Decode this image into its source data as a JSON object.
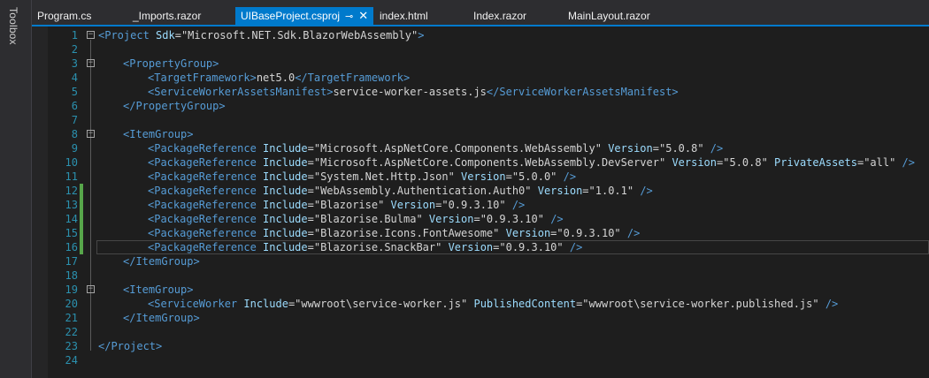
{
  "toolbox": {
    "label": "Toolbox"
  },
  "tabs": [
    {
      "label": "Program.cs",
      "active": false
    },
    {
      "label": "_Imports.razor",
      "active": false
    },
    {
      "label": "UIBaseProject.csproj",
      "active": true
    },
    {
      "label": "index.html",
      "active": false
    },
    {
      "label": "Index.razor",
      "active": false
    },
    {
      "label": "MainLayout.razor",
      "active": false
    }
  ],
  "colors": {
    "accent": "#007acc",
    "tag": "#569cd6",
    "attr": "#9cdcfe",
    "linenum": "#2b91af",
    "changed": "#57a64a"
  },
  "editor": {
    "lines": [
      {
        "n": "1",
        "fold": "minus",
        "changed": false,
        "indent": 0,
        "tokens": [
          [
            "tag",
            "<Project "
          ],
          [
            "attr",
            "Sdk"
          ],
          [
            "val",
            "=\"Microsoft.NET.Sdk.BlazorWebAssembly\""
          ],
          [
            "tag",
            ">"
          ]
        ]
      },
      {
        "n": "2",
        "fold": "",
        "changed": false,
        "indent": 0,
        "tokens": []
      },
      {
        "n": "3",
        "fold": "minus",
        "changed": false,
        "indent": 1,
        "tokens": [
          [
            "tag",
            "<PropertyGroup>"
          ]
        ]
      },
      {
        "n": "4",
        "fold": "",
        "changed": false,
        "indent": 2,
        "tokens": [
          [
            "tag",
            "<TargetFramework>"
          ],
          [
            "txt",
            "net5.0"
          ],
          [
            "tag",
            "</TargetFramework>"
          ]
        ]
      },
      {
        "n": "5",
        "fold": "",
        "changed": false,
        "indent": 2,
        "tokens": [
          [
            "tag",
            "<ServiceWorkerAssetsManifest>"
          ],
          [
            "txt",
            "service-worker-assets.js"
          ],
          [
            "tag",
            "</ServiceWorkerAssetsManifest>"
          ]
        ]
      },
      {
        "n": "6",
        "fold": "",
        "changed": false,
        "indent": 1,
        "tokens": [
          [
            "tag",
            "</PropertyGroup>"
          ]
        ]
      },
      {
        "n": "7",
        "fold": "",
        "changed": false,
        "indent": 0,
        "tokens": []
      },
      {
        "n": "8",
        "fold": "minus",
        "changed": false,
        "indent": 1,
        "tokens": [
          [
            "tag",
            "<ItemGroup>"
          ]
        ]
      },
      {
        "n": "9",
        "fold": "",
        "changed": false,
        "indent": 2,
        "tokens": [
          [
            "tag",
            "<PackageReference "
          ],
          [
            "attr",
            "Include"
          ],
          [
            "val",
            "=\"Microsoft.AspNetCore.Components.WebAssembly\" "
          ],
          [
            "attr",
            "Version"
          ],
          [
            "val",
            "=\"5.0.8\" "
          ],
          [
            "tag",
            "/>"
          ]
        ]
      },
      {
        "n": "10",
        "fold": "",
        "changed": false,
        "indent": 2,
        "tokens": [
          [
            "tag",
            "<PackageReference "
          ],
          [
            "attr",
            "Include"
          ],
          [
            "val",
            "=\"Microsoft.AspNetCore.Components.WebAssembly.DevServer\" "
          ],
          [
            "attr",
            "Version"
          ],
          [
            "val",
            "=\"5.0.8\" "
          ],
          [
            "attr",
            "PrivateAssets"
          ],
          [
            "val",
            "=\"all\" "
          ],
          [
            "tag",
            "/>"
          ]
        ]
      },
      {
        "n": "11",
        "fold": "",
        "changed": false,
        "indent": 2,
        "tokens": [
          [
            "tag",
            "<PackageReference "
          ],
          [
            "attr",
            "Include"
          ],
          [
            "val",
            "=\"System.Net.Http.Json\" "
          ],
          [
            "attr",
            "Version"
          ],
          [
            "val",
            "=\"5.0.0\" "
          ],
          [
            "tag",
            "/>"
          ]
        ]
      },
      {
        "n": "12",
        "fold": "",
        "changed": true,
        "indent": 2,
        "tokens": [
          [
            "tag",
            "<PackageReference "
          ],
          [
            "attr",
            "Include"
          ],
          [
            "val",
            "=\"WebAssembly.Authentication.Auth0\" "
          ],
          [
            "attr",
            "Version"
          ],
          [
            "val",
            "=\"1.0.1\" "
          ],
          [
            "tag",
            "/>"
          ]
        ]
      },
      {
        "n": "13",
        "fold": "",
        "changed": true,
        "indent": 2,
        "tokens": [
          [
            "tag",
            "<PackageReference "
          ],
          [
            "attr",
            "Include"
          ],
          [
            "val",
            "=\"Blazorise\" "
          ],
          [
            "attr",
            "Version"
          ],
          [
            "val",
            "=\"0.9.3.10\" "
          ],
          [
            "tag",
            "/>"
          ]
        ]
      },
      {
        "n": "14",
        "fold": "",
        "changed": true,
        "indent": 2,
        "tokens": [
          [
            "tag",
            "<PackageReference "
          ],
          [
            "attr",
            "Include"
          ],
          [
            "val",
            "=\"Blazorise.Bulma\" "
          ],
          [
            "attr",
            "Version"
          ],
          [
            "val",
            "=\"0.9.3.10\" "
          ],
          [
            "tag",
            "/>"
          ]
        ]
      },
      {
        "n": "15",
        "fold": "",
        "changed": true,
        "indent": 2,
        "tokens": [
          [
            "tag",
            "<PackageReference "
          ],
          [
            "attr",
            "Include"
          ],
          [
            "val",
            "=\"Blazorise.Icons.FontAwesome\" "
          ],
          [
            "attr",
            "Version"
          ],
          [
            "val",
            "=\"0.9.3.10\" "
          ],
          [
            "tag",
            "/>"
          ]
        ]
      },
      {
        "n": "16",
        "fold": "",
        "changed": true,
        "indent": 2,
        "tokens": [
          [
            "tag",
            "<PackageReference "
          ],
          [
            "attr",
            "Include"
          ],
          [
            "val",
            "=\"Blazorise.SnackBar\" "
          ],
          [
            "attr",
            "Version"
          ],
          [
            "val",
            "=\"0.9.3.10\" "
          ],
          [
            "tag",
            "/>"
          ]
        ]
      },
      {
        "n": "17",
        "fold": "",
        "changed": false,
        "indent": 1,
        "tokens": [
          [
            "tag",
            "</ItemGroup>"
          ]
        ]
      },
      {
        "n": "18",
        "fold": "",
        "changed": false,
        "indent": 0,
        "tokens": []
      },
      {
        "n": "19",
        "fold": "minus",
        "changed": false,
        "indent": 1,
        "tokens": [
          [
            "tag",
            "<ItemGroup>"
          ]
        ]
      },
      {
        "n": "20",
        "fold": "",
        "changed": false,
        "indent": 2,
        "tokens": [
          [
            "tag",
            "<ServiceWorker "
          ],
          [
            "attr",
            "Include"
          ],
          [
            "val",
            "=\"wwwroot\\service-worker.js\" "
          ],
          [
            "attr",
            "PublishedContent"
          ],
          [
            "val",
            "=\"wwwroot\\service-worker.published.js\" "
          ],
          [
            "tag",
            "/>"
          ]
        ]
      },
      {
        "n": "21",
        "fold": "",
        "changed": false,
        "indent": 1,
        "tokens": [
          [
            "tag",
            "</ItemGroup>"
          ]
        ]
      },
      {
        "n": "22",
        "fold": "",
        "changed": false,
        "indent": 0,
        "tokens": []
      },
      {
        "n": "23",
        "fold": "",
        "changed": false,
        "indent": 0,
        "tokens": [
          [
            "tag",
            "</Project>"
          ]
        ]
      },
      {
        "n": "24",
        "fold": "",
        "changed": false,
        "indent": 0,
        "tokens": []
      }
    ]
  }
}
